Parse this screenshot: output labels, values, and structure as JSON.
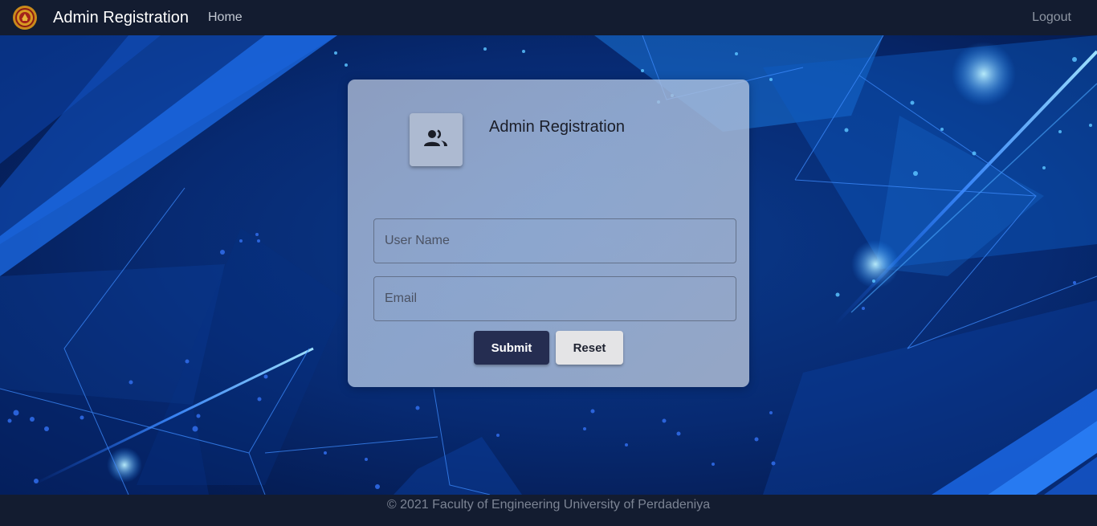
{
  "navbar": {
    "logo_icon": "university-crest-logo",
    "brand": "Admin Registration",
    "home_label": "Home",
    "logout_label": "Logout"
  },
  "card": {
    "header_icon": "people-icon",
    "title": "Admin Registration",
    "username_placeholder": "User Name",
    "email_placeholder": "Email",
    "submit_label": "Submit",
    "reset_label": "Reset"
  },
  "footer": {
    "text": "© 2021 Faculty of Engineering University of Perdadeniya"
  },
  "colors": {
    "navbar_bg": "#131c30",
    "submit_bg": "#252d51",
    "reset_bg": "#e4e4e6",
    "background_blue": "#061a4f"
  }
}
